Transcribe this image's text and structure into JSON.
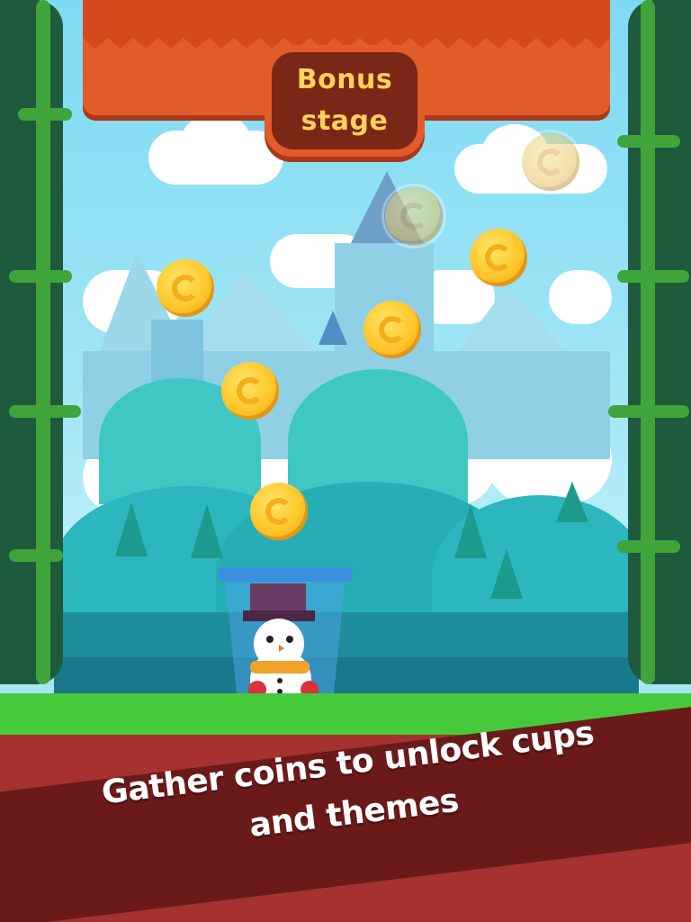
{
  "header": {
    "title_line1": "Bonus",
    "title_line2": "stage"
  },
  "caption": {
    "line1": "Gather coins to unlock cups",
    "line2": "and themes"
  },
  "icons": {
    "coin": "coin-icon",
    "cup": "snowman-cup-icon",
    "vine": "vine-icon"
  },
  "colors": {
    "banner": "#e25c2a",
    "badge_inner": "#7a2717",
    "badge_text": "#ffd25a",
    "coin": "#ffc62a",
    "grass": "#46c93a",
    "soil": "#a5322e",
    "ribbon": "#6a1b19"
  }
}
